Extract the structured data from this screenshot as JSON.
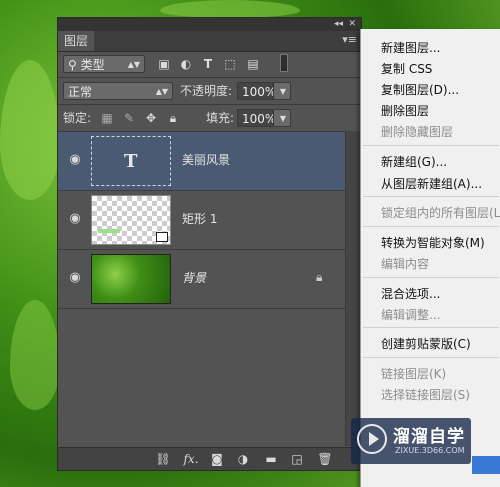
{
  "panel": {
    "tab_label": "图层",
    "collapse_glyph": "◂◂",
    "close_glyph": "✕",
    "menu_glyph": "▾≡",
    "filter": {
      "label": "类型",
      "icon": "search-icon",
      "glyph": "⚲"
    },
    "filter_icons": [
      "image-icon",
      "adjustment-icon",
      "text-icon",
      "shape-icon",
      "smart-object-icon",
      "toggle-switch-icon"
    ],
    "blend_mode": "正常",
    "opacity_label": "不透明度:",
    "opacity_value": "100%",
    "lock_label": "锁定:",
    "fill_label": "填充:",
    "fill_value": "100%",
    "layers": [
      {
        "name": "美丽风景",
        "kind": "text",
        "thumb_glyph": "T",
        "selected": true
      },
      {
        "name": "矩形 1",
        "kind": "shape",
        "selected": false
      },
      {
        "name": "背景",
        "kind": "background",
        "selected": false,
        "locked": true
      }
    ],
    "bottom_icons": [
      "link-icon",
      "fx-icon",
      "mask-icon",
      "adjustment-layer-icon",
      "folder-icon",
      "new-layer-icon",
      "trash-icon"
    ],
    "fx_label": "fx."
  },
  "menu": {
    "items": [
      {
        "label": "新建图层...",
        "enabled": true
      },
      {
        "label": "复制 CSS",
        "enabled": true
      },
      {
        "label": "复制图层(D)...",
        "enabled": true
      },
      {
        "label": "删除图层",
        "enabled": true
      },
      {
        "label": "删除隐藏图层",
        "enabled": false
      },
      {
        "label": "新建组(G)...",
        "enabled": true
      },
      {
        "label": "从图层新建组(A)...",
        "enabled": true
      },
      {
        "label": "锁定组内的所有图层(L)...",
        "enabled": false
      },
      {
        "label": "转换为智能对象(M)",
        "enabled": true
      },
      {
        "label": "编辑内容",
        "enabled": false
      },
      {
        "label": "混合选项...",
        "enabled": true
      },
      {
        "label": "编辑调整...",
        "enabled": false
      },
      {
        "label": "创建剪贴蒙版(C)",
        "enabled": true
      },
      {
        "label": "链接图层(K)",
        "enabled": false
      },
      {
        "label": "选择链接图层(S)",
        "enabled": false
      }
    ]
  },
  "watermark": {
    "title": "溜溜自学",
    "url": "ZIXUE.3D66.COM"
  },
  "colors": {
    "panel": "#535353",
    "selected_layer": "#4b5a73",
    "menu_bg": "#f0f0f0",
    "highlight": "#3a78d6"
  }
}
